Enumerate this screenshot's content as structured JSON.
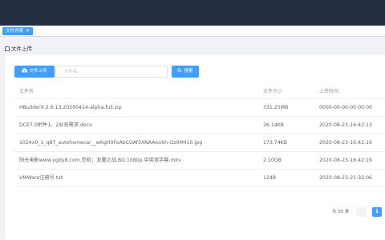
{
  "tab": {
    "label": "文件列表",
    "close": "×"
  },
  "breadcrumb": {
    "label": "文件上传"
  },
  "toolbar": {
    "upload_label": "文件上传",
    "search_placeholder": "文件名",
    "search_label": "搜索"
  },
  "table": {
    "headers": [
      "文件名",
      "文件大小",
      "上传时间"
    ],
    "rows": [
      {
        "name": "HBuilderX.2.6.13.20200414-alpha.full.zip",
        "size": "331.25MB",
        "time": "0000-00-00-00:00:00"
      },
      {
        "name": "DCE7.0附件1、2业务需求.docx",
        "size": "26.14KB",
        "time": "2020-08-23-16:42:13"
      },
      {
        "name": "1024x0_1_q87_autohomecar__wKgH0FoAbCOAf3XNAAooXh-Oz0M410.jpg",
        "size": "173.74KB",
        "time": "2020-08-23-16:42:16"
      },
      {
        "name": "阳光电影www.ygdy8.com.范机：龙屠之战.BD.1080p.中英双字幕.mkv",
        "size": "2.10GB",
        "time": "2020-08-23-16:42:19"
      },
      {
        "name": "VMWare注册号.txt",
        "size": "124B",
        "time": "2020-08-23-21:32:06"
      }
    ]
  },
  "pagination": {
    "total_text": "共 50 条",
    "prev": "‹",
    "current_page": "1"
  },
  "colors": {
    "accent": "#409eff",
    "topbar": "#242f42"
  }
}
